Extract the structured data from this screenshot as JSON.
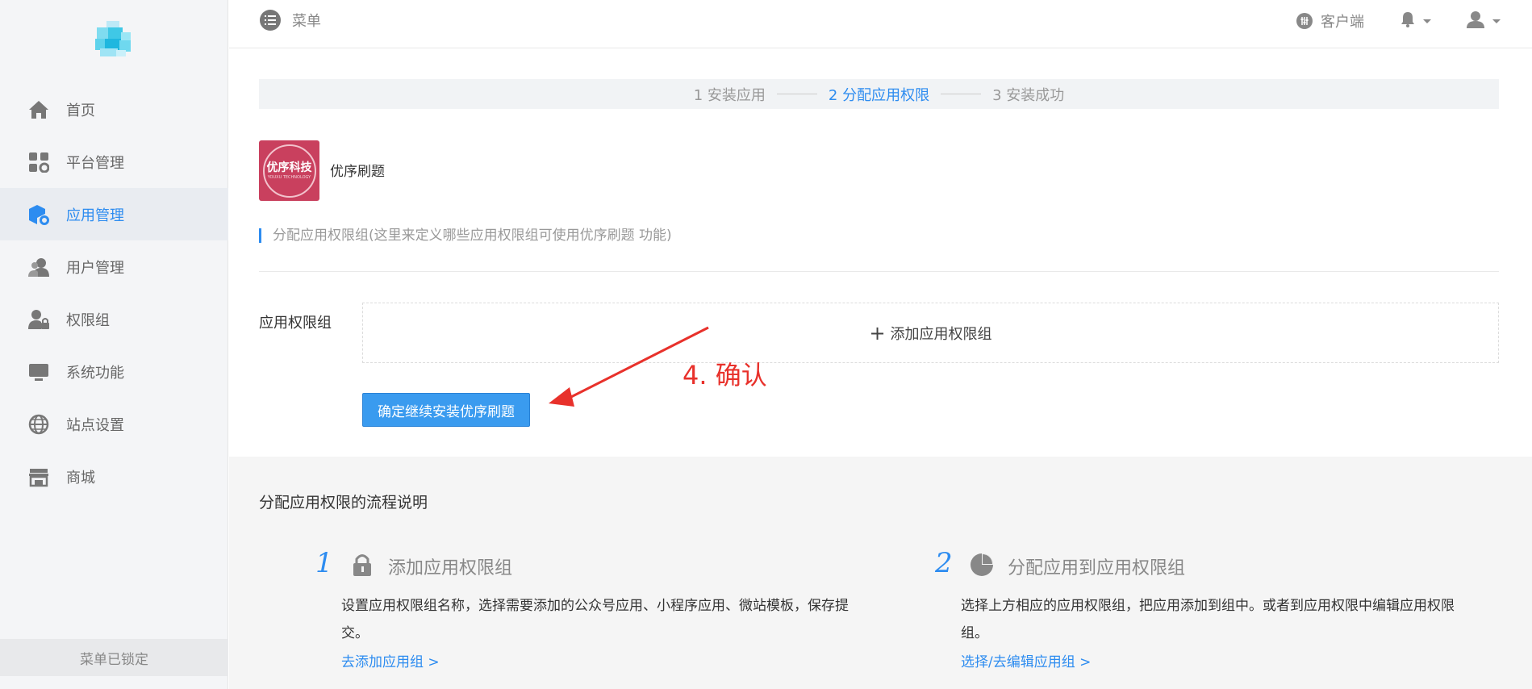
{
  "sidebar": {
    "items": [
      {
        "label": "首页",
        "icon": "home-icon"
      },
      {
        "label": "平台管理",
        "icon": "grid-gear-icon"
      },
      {
        "label": "应用管理",
        "icon": "cube-gear-icon",
        "active": true
      },
      {
        "label": "用户管理",
        "icon": "users-icon"
      },
      {
        "label": "权限组",
        "icon": "user-lock-icon"
      },
      {
        "label": "系统功能",
        "icon": "monitor-icon"
      },
      {
        "label": "站点设置",
        "icon": "globe-icon"
      },
      {
        "label": "商城",
        "icon": "store-icon"
      }
    ],
    "lock_label": "菜单已锁定"
  },
  "topbar": {
    "menu_label": "菜单",
    "client_label": "客户端"
  },
  "steps": [
    {
      "label": "1 安装应用"
    },
    {
      "label": "2 分配应用权限"
    },
    {
      "label": "3 安装成功"
    }
  ],
  "app": {
    "logo_text": "优序科技",
    "logo_subtext": "YOUXU TECHNOLOGY",
    "name": "优序刷题"
  },
  "section_note": "分配应用权限组(这里来定义哪些应用权限组可使用优序刷题 功能)",
  "form": {
    "group_label": "应用权限组",
    "add_label": "添加应用权限组",
    "confirm_label": "确定继续安装优序刷题"
  },
  "annotation": {
    "text": "4. 确认",
    "color": "#e8312b"
  },
  "flow": {
    "title": "分配应用权限的流程说明",
    "steps": [
      {
        "num": "1",
        "heading": "添加应用权限组",
        "desc": "设置应用权限组名称，选择需要添加的公众号应用、小程序应用、微站模板，保存提交。",
        "link": "去添加应用组 >"
      },
      {
        "num": "2",
        "heading": "分配应用到应用权限组",
        "desc": "选择上方相应的应用权限组，把应用添加到组中。或者到应用权限中编辑应用权限组。",
        "link": "选择/去编辑应用组 >"
      }
    ]
  },
  "colors": {
    "accent": "#2d8cf0",
    "button": "#3a9bef",
    "app_logo_bg": "#c9405e"
  }
}
